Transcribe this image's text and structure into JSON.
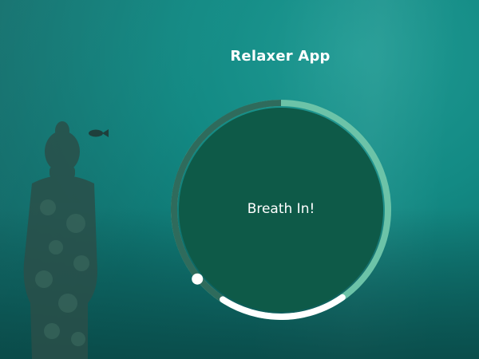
{
  "app": {
    "title": "Relaxer App"
  },
  "breathing": {
    "instruction": "Breath In!",
    "progress": 0.39
  },
  "icons": {
    "pointer": "pointer-dot-icon",
    "statue": "statue-image",
    "fish": "fish-image"
  },
  "colors": {
    "circle_fill": "#0e5a48",
    "ring_dark": "#2f6b5c",
    "ring_light": "#6cc3a8",
    "ring_white": "#ffffff"
  }
}
